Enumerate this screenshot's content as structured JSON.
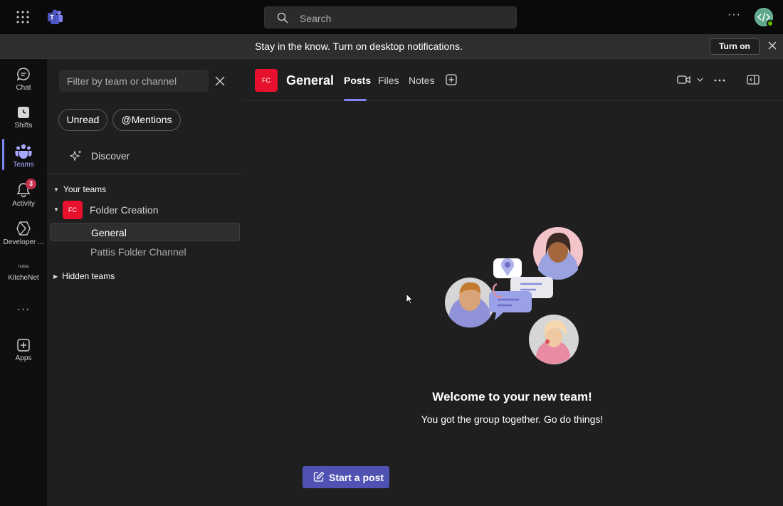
{
  "titlebar": {
    "search_placeholder": "Search",
    "more": "···"
  },
  "notification": {
    "message": "Stay in the know. Turn on desktop notifications.",
    "turn_on_label": "Turn on"
  },
  "rail": {
    "items": [
      {
        "label": "Chat",
        "icon": "chat-icon"
      },
      {
        "label": "Shifts",
        "icon": "shifts-icon"
      },
      {
        "label": "Teams",
        "icon": "teams-icon",
        "active": true
      },
      {
        "label": "Activity",
        "icon": "bell-icon",
        "badge": "3"
      },
      {
        "label": "Developer ...",
        "icon": "developer-portal-icon"
      },
      {
        "label": "KitcheNet",
        "icon": "kitchenet-icon",
        "logo_text": "nubia"
      },
      {
        "label": "Apps",
        "icon": "add-apps-icon"
      }
    ],
    "more": "···"
  },
  "panel": {
    "filter_placeholder": "Filter by team or channel",
    "pills": [
      "Unread",
      "@Mentions"
    ],
    "discover_label": "Discover",
    "your_teams_label": "Your teams",
    "team": {
      "initials": "FC",
      "name": "Folder Creation",
      "channels": [
        "General",
        "Pattis Folder Channel"
      ]
    },
    "hidden_teams_label": "Hidden teams"
  },
  "main": {
    "channel_initials": "FC",
    "channel_title": "General",
    "tabs": [
      "Posts",
      "Files",
      "Notes"
    ],
    "welcome_title": "Welcome to your new team!",
    "welcome_subtitle": "You got the group together. Go do things!",
    "start_post_label": "Start a post"
  },
  "colors": {
    "accent": "#7f85f5",
    "team_avatar": "#e8112d",
    "button": "#4f52b2",
    "badge": "#c4314b"
  }
}
